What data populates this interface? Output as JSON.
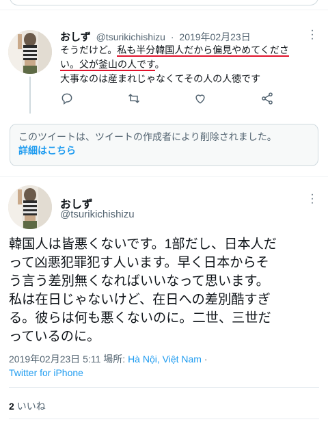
{
  "reply_tweet": {
    "name": "おしず",
    "handle": "@tsurikichishizu",
    "separator": "·",
    "date": "2019年02月23日",
    "lines": [
      {
        "plain": "そうだけど。",
        "highlight": "私も半分韓国人だから偏見やめてくださ"
      },
      {
        "highlight2": "い。父が釜山の人です",
        "plain2": "。"
      },
      {
        "plain": "大事なのは産まれじゃなくてその人の人徳です"
      }
    ],
    "actions": [
      "reply-icon",
      "retweet-icon",
      "like-icon",
      "share-icon"
    ]
  },
  "deleted_notice": {
    "message": "このツイートは、ツイートの作成者により削除されました。",
    "link": "詳細はこちら"
  },
  "main_tweet": {
    "name": "おしず",
    "handle": "@tsurikichishizu",
    "lines": [
      "韓国人は皆悪くないです。1部だし、日本人だ",
      "って凶悪犯罪犯す人います。早く日本からそ",
      "う言う差別無くなればいいなって思います。",
      "私は在日じゃないけど、在日への差別酷すぎ",
      "る。彼らは何も悪くないのに。二世、三世だ",
      "っているのに。"
    ],
    "timestamp": "2019年02月23日 5:11 場所:",
    "place": "Hà Nội, Việt Nam",
    "dot": " ·",
    "source": "Twitter for iPhone",
    "likes_count": "2",
    "likes_label": "いいね"
  },
  "colors": {
    "accent": "#1d9bf0",
    "highlight_underline": "#e0112b",
    "muted": "#536471"
  }
}
